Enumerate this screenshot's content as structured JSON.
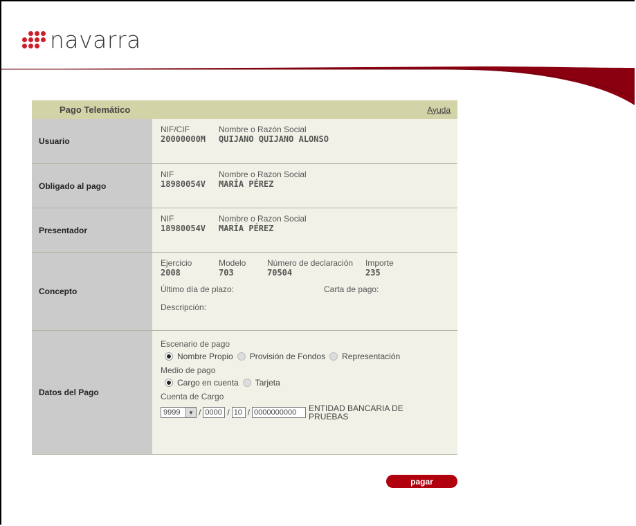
{
  "brand": {
    "name": "navarra",
    "color": "#cc1d2a",
    "accent": "#8a0010"
  },
  "panel": {
    "title": "Pago Telemático",
    "help_link": "Ayuda"
  },
  "usuario": {
    "label": "Usuario",
    "id_label": "NIF/CIF",
    "name_label": "Nombre o Razón Social",
    "id_value": "20000000M",
    "name_value": "QUIJANO QUIJANO ALONSO"
  },
  "obligado": {
    "label": "Obligado al pago",
    "id_label": "NIF",
    "name_label": "Nombre o Razon Social",
    "id_value": "18980054V",
    "name_value": "MARÍA PÉREZ"
  },
  "presentador": {
    "label": "Presentador",
    "id_label": "NIF",
    "name_label": "Nombre o Razon Social",
    "id_value": "18980054V",
    "name_value": "MARÍA PÉREZ"
  },
  "concepto": {
    "label": "Concepto",
    "ejercicio_label": "Ejercicio",
    "ejercicio_value": "2008",
    "modelo_label": "Modelo",
    "modelo_value": "703",
    "numero_label": "Número de declaración",
    "numero_value": "70504",
    "importe_label": "Importe",
    "importe_value": "235",
    "ultimo_dia_label": "Último día de plazo:",
    "carta_label": "Carta de pago:",
    "descripcion_label": "Descripción:"
  },
  "datos_pago": {
    "label": "Datos del Pago",
    "escenario_label": "Escenario de pago",
    "escenario_options": [
      "Nombre Propio",
      "Provisión de Fondos",
      "Representación"
    ],
    "medio_label": "Medio de pago",
    "medio_options": [
      "Cargo en cuenta",
      "Tarjeta"
    ],
    "cuenta_label": "Cuenta de Cargo",
    "entidad_select": "9999",
    "oficina": "0000",
    "dc": "10",
    "cuenta": "0000000000",
    "entidad_name": "ENTIDAD BANCARIA DE PRUEBAS"
  },
  "actions": {
    "pay_label": "pagar"
  }
}
